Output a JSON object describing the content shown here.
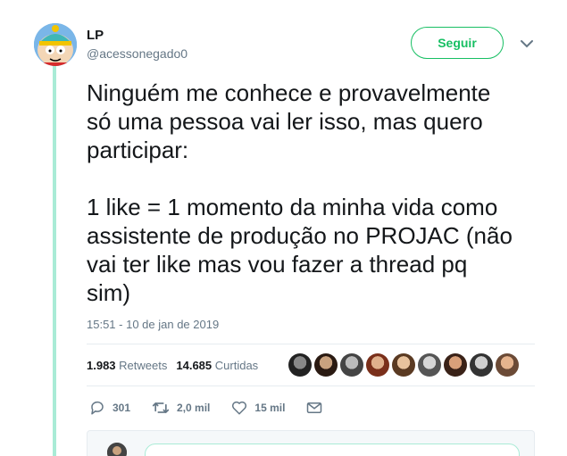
{
  "header": {
    "display_name": "LP",
    "handle": "@acessonegado0",
    "follow_label": "Seguir"
  },
  "tweet": {
    "text": "Ninguém me conhece e provavelmente\nsó uma pessoa vai ler isso, mas quero\nparticipar:\n\n1 like = 1 momento da minha vida como\nassistente de produção no PROJAC (não\nvai ter like mas vou fazer a thread pq\nsim)",
    "timestamp": "15:51 - 10 de jan de 2019"
  },
  "stats": {
    "retweets_count": "1.983",
    "retweets_label": "Retweets",
    "likes_count": "14.685",
    "likes_label": "Curtidas"
  },
  "actions": {
    "reply_count": "301",
    "retweet_count": "2,0 mil",
    "like_count": "15 mil"
  },
  "colors": {
    "accent": "#17bf63",
    "thread_line": "#a9ebd6",
    "muted": "#657786"
  }
}
